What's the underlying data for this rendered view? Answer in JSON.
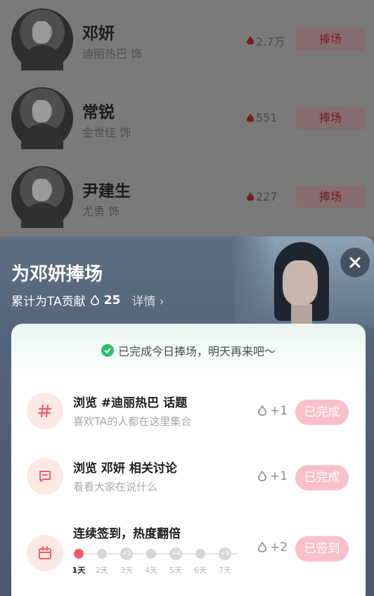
{
  "list": [
    {
      "name": "邓妍",
      "role": "迪丽热巴 饰",
      "heat": "2.7万",
      "button": "捧场"
    },
    {
      "name": "常锐",
      "role": "金世佳 饰",
      "heat": "551",
      "button": "捧场"
    },
    {
      "name": "尹建生",
      "role": "尤勇 饰",
      "heat": "227",
      "button": "捧场"
    }
  ],
  "sheet": {
    "title": "为邓妍捧场",
    "contrib_label": "累计为TA贡献",
    "contrib_value": "25",
    "detail": "详情 ›",
    "notice": "已完成今日捧场，明天再来吧～",
    "tasks": [
      {
        "name": "浏览 #迪丽热巴 话题",
        "sub": "喜欢TA的人都在这里集合",
        "reward": "+1",
        "status": "已完成",
        "icon": "hash-icon"
      },
      {
        "name": "浏览 邓妍 相关讨论",
        "sub": "看看大家在说什么",
        "reward": "+1",
        "status": "已完成",
        "icon": "chat-icon"
      },
      {
        "name": "连续签到，热度翻倍",
        "reward": "+2",
        "status": "已签到",
        "icon": "calendar-icon"
      }
    ],
    "days": [
      "1天",
      "2天",
      "3天",
      "4天",
      "5天",
      "6天",
      "7天"
    ],
    "bonus_marks": [
      "+2",
      "+4",
      "+8"
    ]
  },
  "colors": {
    "accent": "#f25b6d",
    "done_button": "#f9c0c9",
    "check": "#2fbf6b"
  }
}
